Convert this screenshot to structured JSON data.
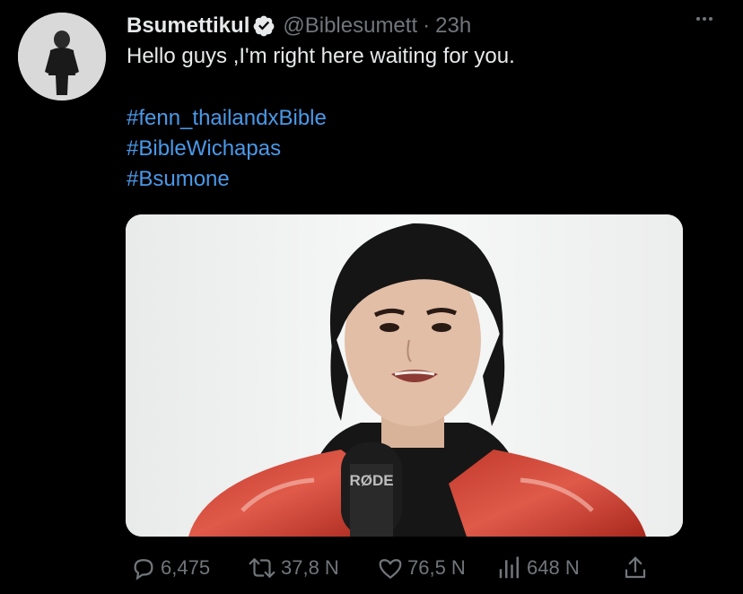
{
  "tweet": {
    "author": {
      "display_name": "Bsumettikul",
      "handle": "@Biblesumett",
      "verified": true
    },
    "separator": "·",
    "time": "23h",
    "text": "Hello guys ,I'm right here waiting for you.",
    "hashtags": [
      "#fenn_thailandxBible",
      "#BibleWichapas",
      "#Bsumone"
    ],
    "media": {
      "microphone_brand": "RØDE"
    },
    "stats": {
      "replies": "6,475",
      "retweets": "37,8 N",
      "likes": "76,5 N",
      "views": "648 N"
    }
  },
  "icons": {
    "more": "more-dots-icon",
    "reply": "reply-bubble-icon",
    "retweet": "retweet-icon",
    "like": "heart-icon",
    "views": "bar-chart-icon",
    "share": "share-upload-icon",
    "verified": "verified-badge-icon"
  },
  "colors": {
    "background": "#000000",
    "text": "#e7e9ea",
    "muted": "#71767b",
    "link": "#4a99e9"
  }
}
